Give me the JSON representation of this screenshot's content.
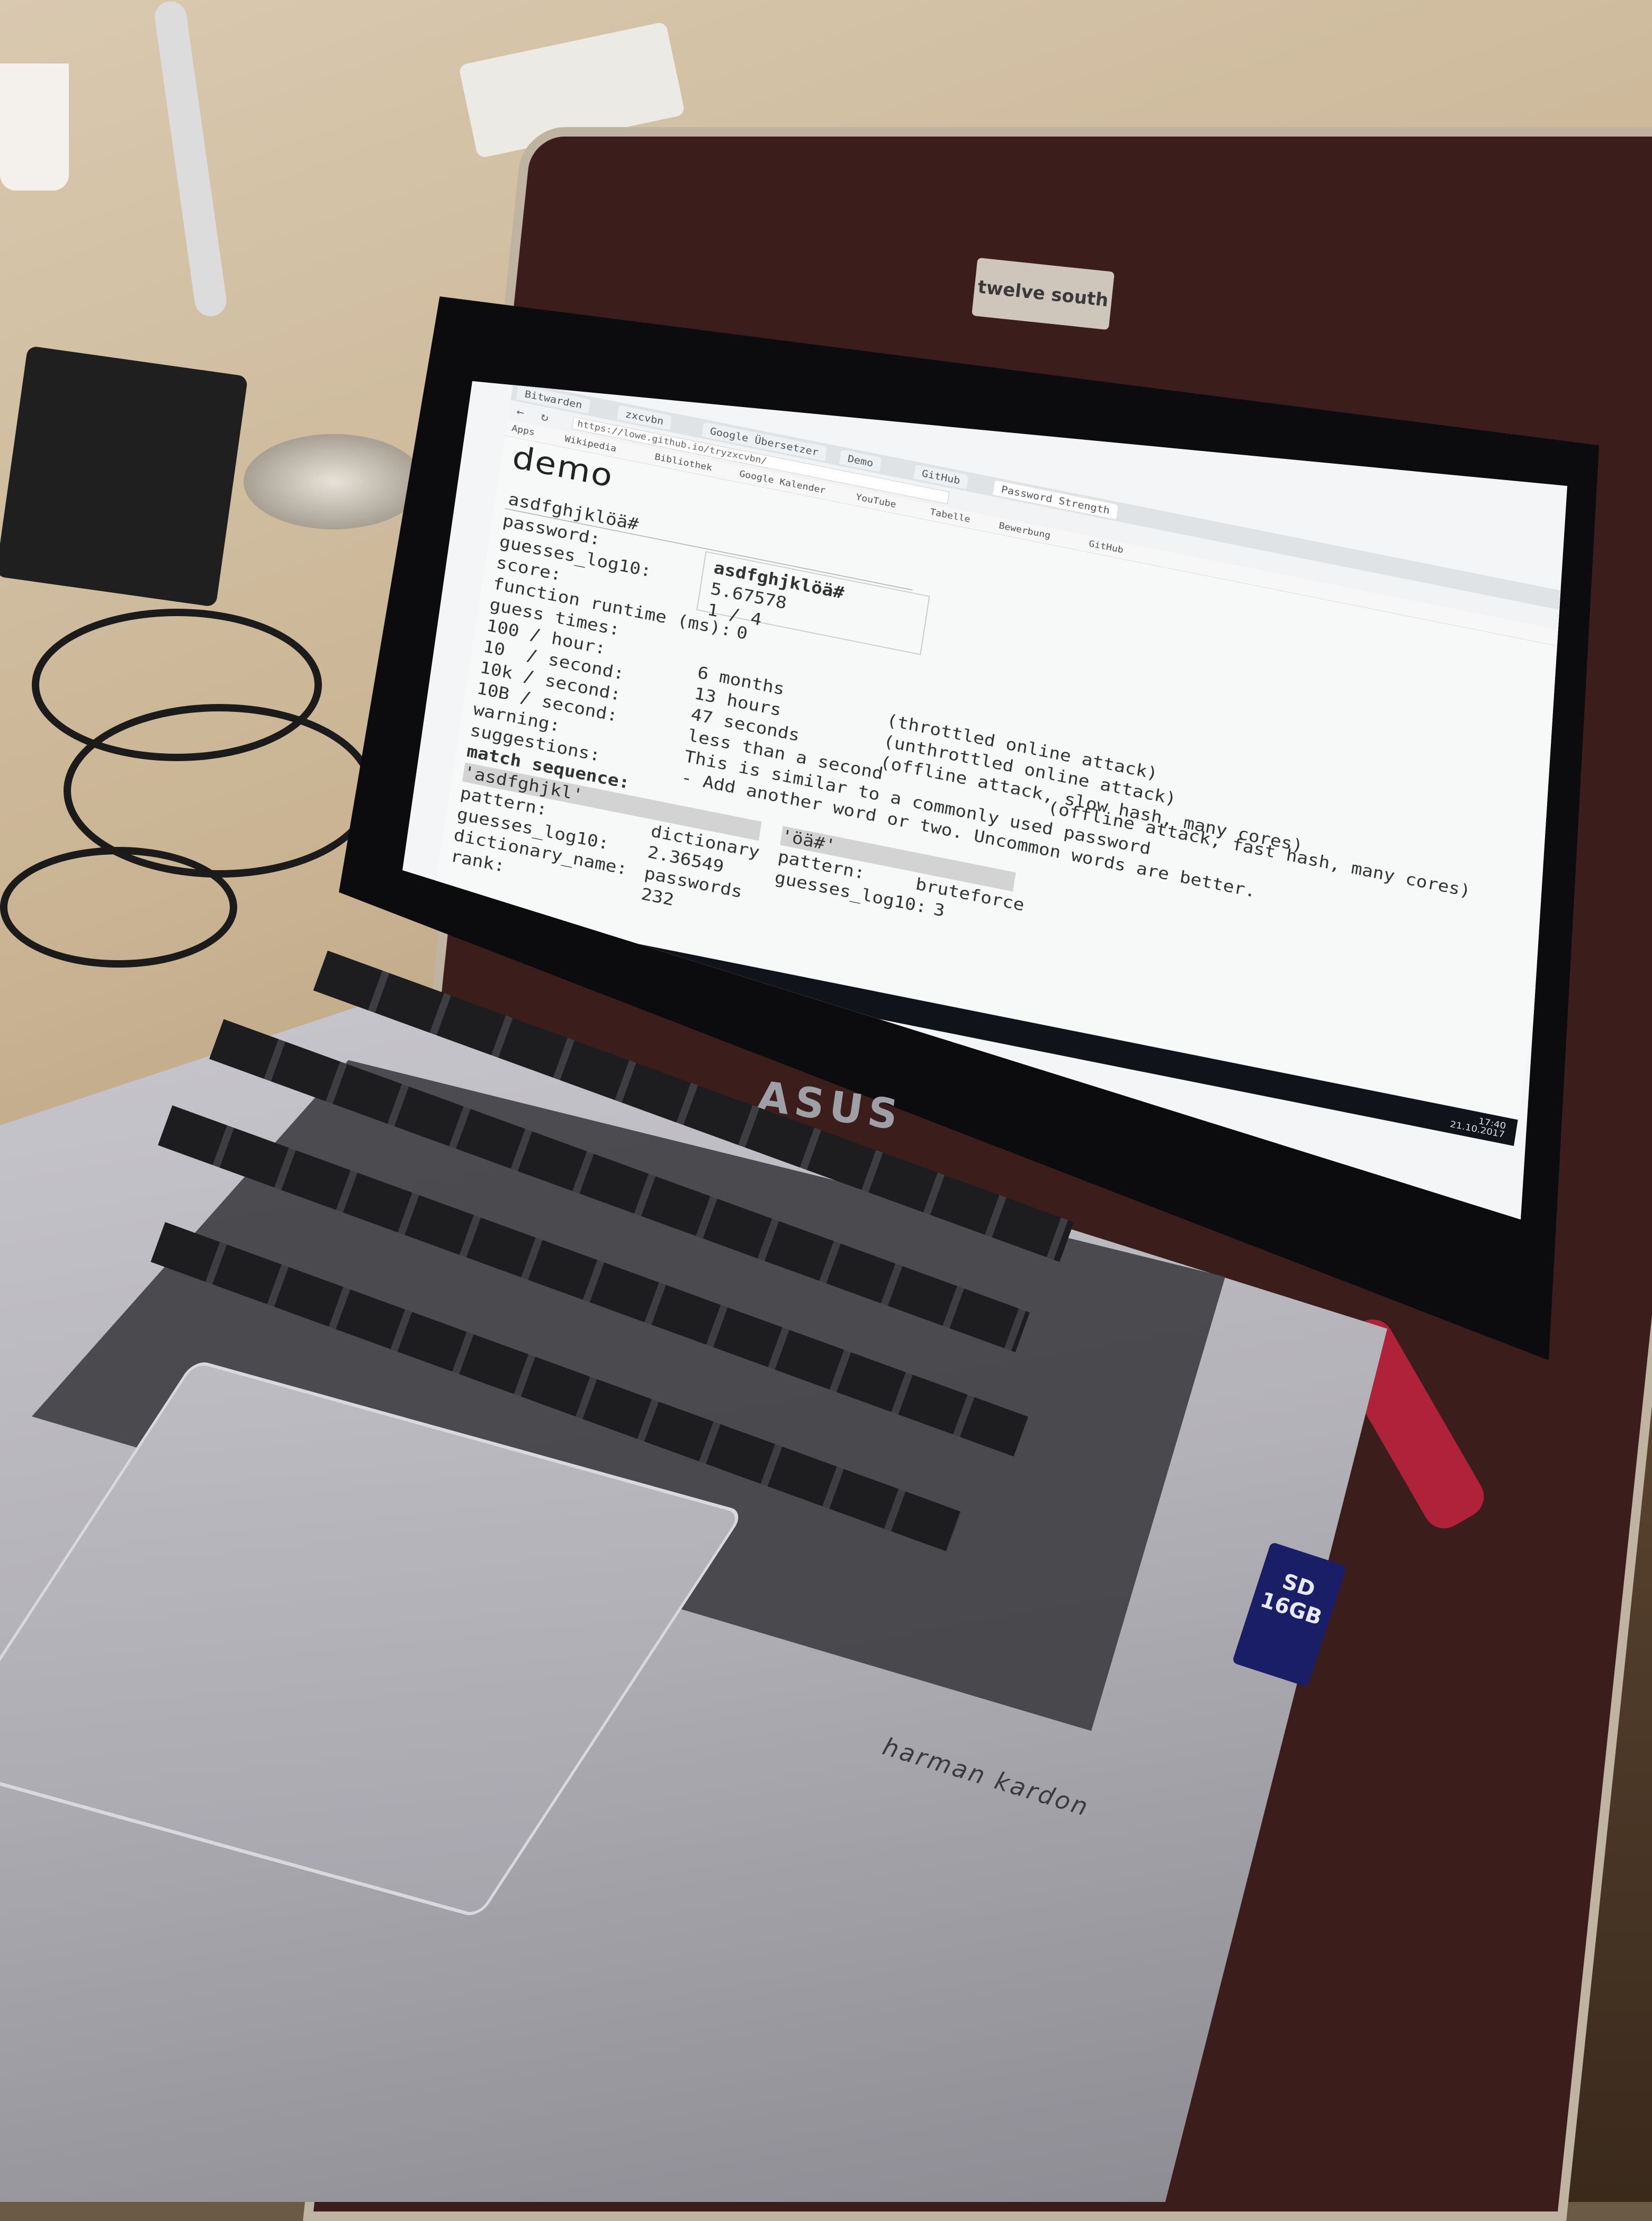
{
  "scene": {
    "sleeve_label": "twelve south",
    "laptop_brand": "ASUS",
    "audio_brand": "harman kardon",
    "sd_card_label": "SD 16GB"
  },
  "browser": {
    "tabs": [
      "Bitwarden",
      "zxcvbn",
      "Google Übersetzer",
      "Demo",
      "GitHub",
      "Password Strength"
    ],
    "url": "https://lowe.github.io/tryzxcvbn/",
    "bookmarks": [
      "Apps",
      "Wikipedia",
      "Bibliothek",
      "Google Kalender",
      "YouTube",
      "Tabelle",
      "Bewerbung",
      "GitHub"
    ]
  },
  "page": {
    "logo": "demo",
    "password_value": "asdfghjklöä#",
    "fields": [
      {
        "label": "password:",
        "value": "asdfghjklöä#"
      },
      {
        "label": "guesses_log10:",
        "value": "5.67578"
      },
      {
        "label": "score:",
        "value": "1 / 4"
      },
      {
        "label": "function runtime (ms):",
        "value": "0"
      }
    ],
    "guess_times_label": "guess times:",
    "guess_times": [
      {
        "label": "100 / hour:",
        "value": "6 months",
        "note": "(throttled online attack)"
      },
      {
        "label": "10  / second:",
        "value": "13 hours",
        "note": "(unthrottled online attack)"
      },
      {
        "label": "10k / second:",
        "value": "47 seconds",
        "note": "(offline attack, slow hash, many cores)"
      },
      {
        "label": "10B / second:",
        "value": "less than a second",
        "note": "(offline attack, fast hash, many cores)"
      }
    ],
    "warning_label": "warning:",
    "warning": "This is similar to a commonly used password",
    "suggestions_label": "suggestions:",
    "suggestion": "- Add another word or two. Uncommon words are better.",
    "match_sequence_label": "match sequence:",
    "matches": [
      {
        "token": "'asdfghjkl'",
        "pattern_label": "pattern:",
        "pattern": "dictionary",
        "log_label": "guesses_log10:",
        "log": "2.36549",
        "dict_label": "dictionary_name:",
        "dict": "passwords",
        "rank_label": "rank:",
        "rank": "232"
      },
      {
        "token": "'öä#'",
        "pattern_label": "pattern:",
        "pattern": "bruteforce",
        "log_label": "guesses_log10:",
        "log": "3"
      }
    ]
  },
  "taskbar": {
    "time": "17:40",
    "date": "21.10.2017"
  },
  "colors": {
    "sleeve": "#3b1e1c",
    "screen_bg": "#f7f8f8",
    "taskbar": "#10131a",
    "laptop_silver": "#b3b2b8"
  }
}
